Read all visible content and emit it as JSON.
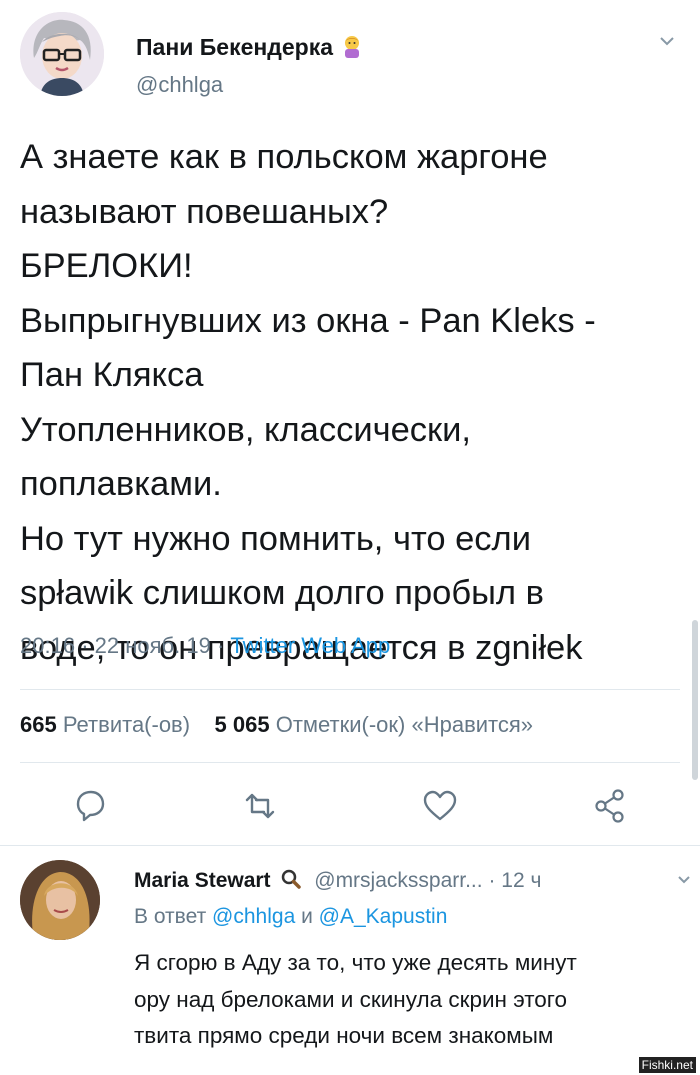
{
  "tweet": {
    "author_name": "Пани Бекендерка",
    "author_handle": "@chhlga",
    "lines": [
      "А знаете как в польском жаргоне",
      "называют повешаных?",
      "БРЕЛОКИ!",
      "Выпрыгнувших из окна - Pan Kleks -",
      "Пан Клякса",
      "Утопленников, классически,",
      "поплавками.",
      "Но тут нужно помнить, что если",
      "spławik слишком долго пробыл в",
      "воде, то он превращается в zgniłek"
    ],
    "time": "20:16",
    "date": "22 нояб. 19",
    "source": "Twitter Web App",
    "retweets_count": "665",
    "retweets_label": "Ретвита(-ов)",
    "likes_count": "5 065",
    "likes_label": "Отметки(-ок) «Нравится»"
  },
  "reply": {
    "author_name": "Maria Stewart",
    "author_handle": "@mrsjackssparr...",
    "time": "12 ч",
    "reply_prefix": "В ответ",
    "mention1": "@chhlga",
    "conj": "и",
    "mention2": "@A_Kapustin",
    "lines": [
      "Я сгорю в Аду за то, что уже десять минут",
      "ору над брелоками и скинула скрин этого",
      "твита прямо среди ночи всем знакомым"
    ]
  },
  "watermark": "Fishki.net",
  "icons": {
    "caret": "chevron-down-icon",
    "emoji": "woman-raising-hand-emoji",
    "reply": "reply-icon",
    "retweet": "retweet-icon",
    "like": "heart-icon",
    "share": "share-icon",
    "search": "magnifier-icon"
  },
  "colors": {
    "text": "#14171a",
    "secondary": "#657786",
    "link": "#1b95e0",
    "divider": "#e1e8ed"
  }
}
